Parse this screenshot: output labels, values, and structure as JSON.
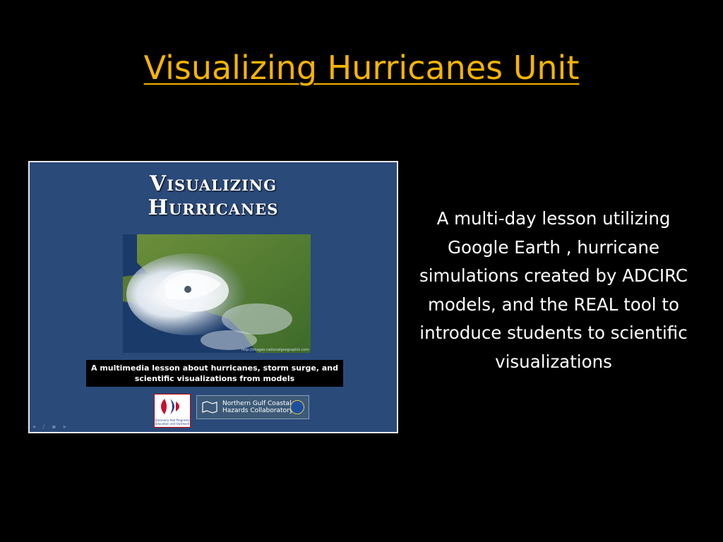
{
  "slide": {
    "title": "Visualizing Hurricanes Unit",
    "description": "A multi-day lesson utilizing Google Earth , hurricane simulations created by ADCIRC models, and the REAL tool to introduce students to scientific visualizations"
  },
  "thumbnail": {
    "title_line1": "Visualizing",
    "title_line2": "Hurricanes",
    "image_credit": "http://images.nationalgeographic.com",
    "caption_line1": "A multimedia lesson about hurricanes, storm surge, and",
    "caption_line2": "scientific visualizations from models",
    "logo1_text": "Discovery Hall Programs Education and Outreach",
    "logo2_line1": "Northern Gulf Coastal",
    "logo2_line2": "Hazards Collaboratory",
    "controls": "◂ ∕ ▪ ▸"
  },
  "colors": {
    "background": "#000000",
    "title": "#f5b400",
    "thumbnail_bg": "#2a4a7a",
    "text": "#ffffff"
  }
}
